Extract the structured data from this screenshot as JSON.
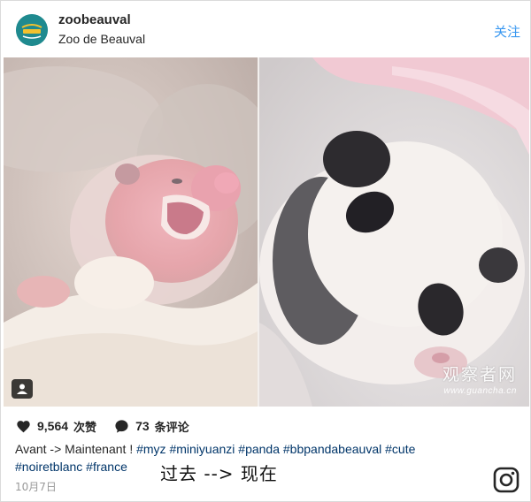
{
  "post": {
    "username": "zoobeauval",
    "location": "Zoo de Beauval",
    "follow_label": "关注",
    "avatar_text": "ZooParc BEAUVAL",
    "likes_count": "9,564",
    "likes_label": "次赞",
    "comments_count": "73",
    "comments_label": "条评论",
    "caption_text": "Avant -> Maintenant !",
    "hashtags": [
      "#myz",
      "#miniyuanzi",
      "#panda",
      "#bbpandabeauval",
      "#cute",
      "#noiretblanc",
      "#france"
    ],
    "date": "10月7日"
  },
  "overlay": {
    "note": "过去 --> 现在"
  },
  "watermark": {
    "cn": "观察者网",
    "url": "www.guancha.cn"
  },
  "icons": {
    "heart": "heart-icon",
    "comment": "comment-bubble-icon",
    "usertag": "user-tag-icon",
    "instagram": "instagram-icon"
  },
  "colors": {
    "link": "#3897f0",
    "hashtag": "#003569",
    "avatar_bg": "#1f8a8f"
  }
}
